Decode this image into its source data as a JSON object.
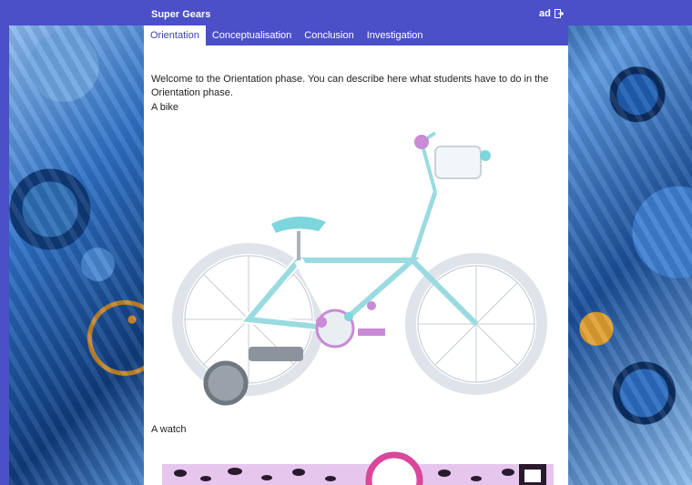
{
  "header": {
    "brand": "Super Gears",
    "user": "ad",
    "logout_icon": "logout-icon",
    "bar_color": "#4b4fc8"
  },
  "tabs": [
    {
      "label": "Orientation",
      "active": true
    },
    {
      "label": "Conceptualisation",
      "active": false
    },
    {
      "label": "Conclusion",
      "active": false
    },
    {
      "label": "Investigation",
      "active": false
    }
  ],
  "main": {
    "intro": "Welcome to the Orientation phase. You can describe here what students have to do in the Orientation phase.",
    "caption_bike": "A bike",
    "caption_watch": "A watch"
  }
}
